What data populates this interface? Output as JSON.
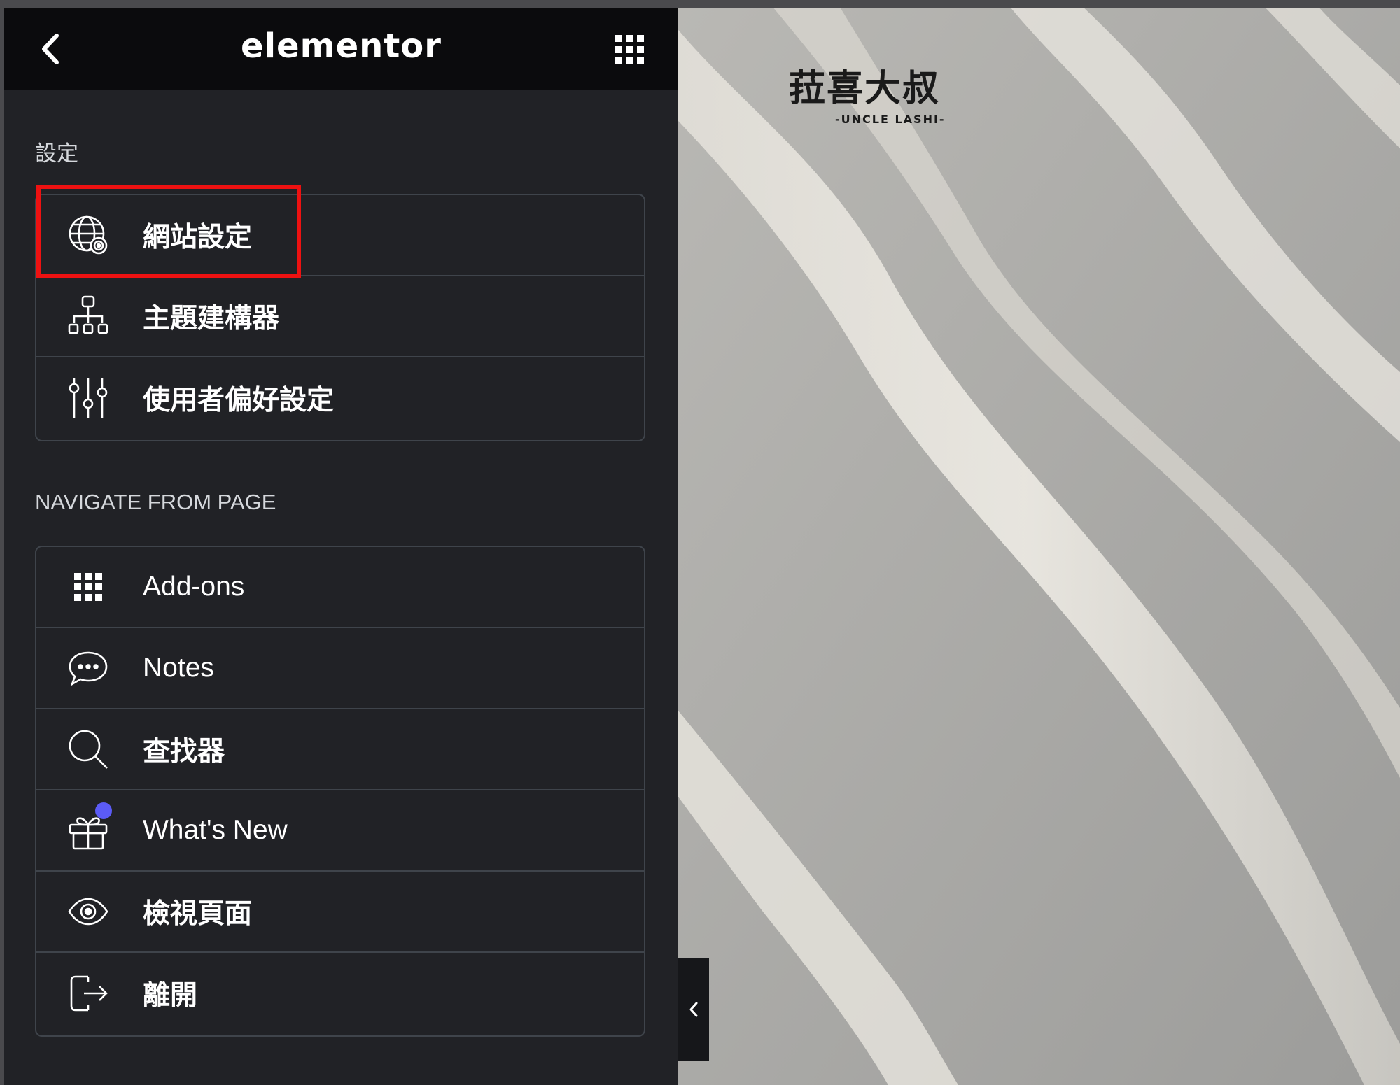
{
  "topbar": {
    "logo": "elementor"
  },
  "settings_section": {
    "title": "設定",
    "items": [
      {
        "label": "網站設定",
        "icon": "globe-gear-icon"
      },
      {
        "label": "主題建構器",
        "icon": "sitemap-icon"
      },
      {
        "label": "使用者偏好設定",
        "icon": "sliders-icon"
      }
    ]
  },
  "navigate_section": {
    "title": "NAVIGATE FROM PAGE",
    "items": [
      {
        "label": "Add-ons",
        "icon": "grid-icon"
      },
      {
        "label": "Notes",
        "icon": "chat-bubble-icon"
      },
      {
        "label": "查找器",
        "icon": "search-icon"
      },
      {
        "label": "What's New",
        "icon": "gift-icon",
        "has_badge": true
      },
      {
        "label": "檢視頁面",
        "icon": "eye-icon"
      },
      {
        "label": "離開",
        "icon": "exit-icon"
      }
    ]
  },
  "preview": {
    "logo_text": "菈喜大叔",
    "logo_subtitle": "-UNCLE LASHI-"
  },
  "colors": {
    "panel_bg": "#212226",
    "topbar_bg": "#0b0b0d",
    "highlight": "#ee1111",
    "badge": "#5b5bf6"
  }
}
